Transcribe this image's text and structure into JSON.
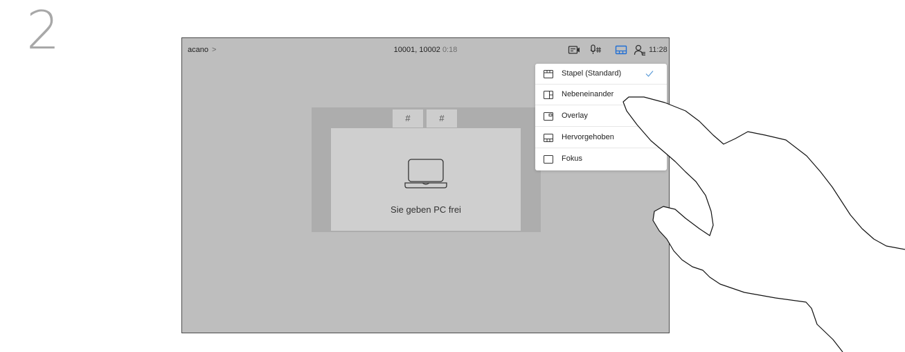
{
  "step": {
    "number": "2"
  },
  "topbar": {
    "breadcrumb": "acano",
    "breadcrumb_chevron": ">",
    "call_numbers": "10001, 10002",
    "call_duration": "0:18",
    "time": "11:28",
    "icons": [
      "self-view-icon",
      "microphone-keypad-icon",
      "layout-icon",
      "participants-icon"
    ],
    "accent_color": "#1f6ed4"
  },
  "share": {
    "hash_left": "#",
    "hash_right": "#",
    "message": "Sie geben PC frei"
  },
  "layout_menu": {
    "items": [
      {
        "label": "Stapel (Standard)",
        "icon": "stack-layout-icon",
        "selected": true
      },
      {
        "label": "Nebeneinander",
        "icon": "side-by-side-layout-icon",
        "selected": false
      },
      {
        "label": "Overlay",
        "icon": "overlay-layout-icon",
        "selected": false
      },
      {
        "label": "Hervorgehoben",
        "icon": "prominent-layout-icon",
        "selected": false
      },
      {
        "label": "Fokus",
        "icon": "focus-layout-icon",
        "selected": false
      }
    ],
    "check_color": "#5a9bd8"
  }
}
